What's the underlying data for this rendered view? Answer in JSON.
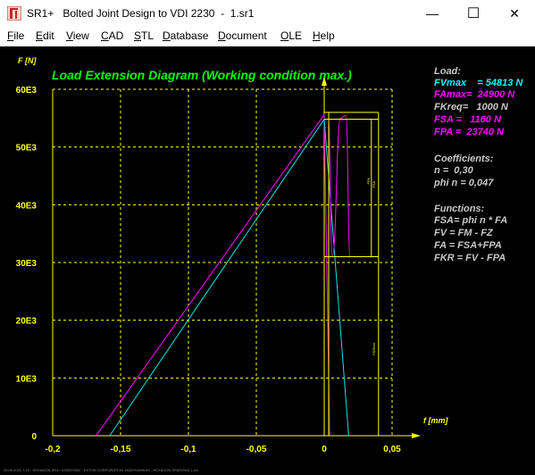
{
  "window": {
    "title": "SR1+   Bolted Joint Design to VDI 2230  -  1.sr1",
    "minimize_glyph": "—",
    "maximize_glyph": "☐",
    "close_glyph": "✕"
  },
  "menu": [
    {
      "label": "File",
      "accel": "F",
      "rest": "ile"
    },
    {
      "label": "Edit",
      "accel": "E",
      "rest": "dit"
    },
    {
      "label": "View",
      "accel": "V",
      "rest": "iew"
    },
    {
      "label": "CAD",
      "accel": "C",
      "rest": "AD"
    },
    {
      "label": "STL",
      "accel": "S",
      "rest": "TL"
    },
    {
      "label": "Database",
      "accel": "D",
      "rest": "atabase"
    },
    {
      "label": "Document",
      "accel": "D",
      "rest": "ocument"
    },
    {
      "label": "OLE",
      "accel": "O",
      "rest": "LE"
    },
    {
      "label": "Help",
      "accel": "H",
      "rest": "elp"
    }
  ],
  "chart_data": {
    "type": "line",
    "title": "Load Extension Diagram (Working condition max.)",
    "ylabel": "F [N]",
    "xlabel": "f [mm]",
    "xlim": [
      -0.2,
      0.05
    ],
    "ylim": [
      0,
      60000
    ],
    "x_ticks": [
      "-0,2",
      "-0,15",
      "-0,1",
      "-0,05",
      "0",
      "0,05"
    ],
    "y_ticks": [
      "0",
      "10E3",
      "20E3",
      "30E3",
      "40E3",
      "50E3",
      "60E3"
    ],
    "grid": true,
    "series": [
      {
        "color": "#ff00ff",
        "points": [
          [
            -0.168,
            0
          ],
          [
            0,
            55600
          ],
          [
            0.004,
            0
          ]
        ]
      },
      {
        "color": "#00e5e5",
        "points": [
          [
            -0.158,
            0
          ],
          [
            0,
            54813
          ],
          [
            0.018,
            0
          ]
        ]
      }
    ],
    "vibration_curve": {
      "color": "#ff00ff",
      "points": [
        [
          0.003,
          55000
        ],
        [
          0.006,
          31000
        ],
        [
          0.012,
          55000
        ],
        [
          0.016,
          55500
        ],
        [
          0.019,
          31000
        ],
        [
          0.024,
          31000
        ]
      ]
    },
    "bracket": {
      "color": "#ffff00",
      "y_top": 56000,
      "y_mid": 54813,
      "y_bottom": 31000,
      "x_right": 0.04
    },
    "small_labels": {
      "fsa": "FSA",
      "fpa": "FPA",
      "fkr": "FKRem"
    }
  },
  "info": {
    "load_header": "Load:",
    "fvmax": "FVmax    = 54813 N",
    "famax": "FAmax=  24900 N",
    "fkreq": "FKreq=   1000 N",
    "fsa": "FSA =   1160 N",
    "fpa": "FPA =  23740 N",
    "coeff_header": "Coefficients:",
    "n": "n =  0,30",
    "phi_n": "phi n = 0,047",
    "func_header": "Functions:",
    "f1": "FSA= phi n * FA",
    "f2": "FV = FM - FZ",
    "f3": "FA = FSA+FPA",
    "f4": "FKR = FV - FPA"
  },
  "footer": "29.05.2021 7:20 · HEXAGON SR1+ V2020/0000 · EXTON CORPORATION 3032/HWWKAS · HEXAGON SPAROW0 1.sr1",
  "colors": {
    "green_title": "#00ff00",
    "yellow": "#ffff00",
    "cyan": "#00ffff",
    "magenta": "#ff00ff",
    "info_gray": "#c8c8c8"
  }
}
